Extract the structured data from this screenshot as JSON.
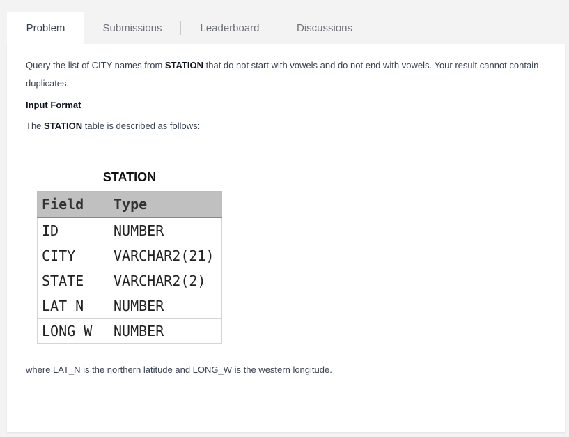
{
  "tabs": [
    {
      "label": "Problem",
      "active": true
    },
    {
      "label": "Submissions",
      "active": false
    },
    {
      "label": "Leaderboard",
      "active": false
    },
    {
      "label": "Discussions",
      "active": false
    }
  ],
  "problem": {
    "intro_prefix": "Query the list of CITY names from ",
    "intro_bold": "STATION",
    "intro_suffix": " that do not start with vowels and do not end with vowels. Your result cannot contain duplicates.",
    "input_format_heading": "Input Format",
    "table_desc_prefix": "The ",
    "table_desc_bold": "STATION",
    "table_desc_suffix": " table is described as follows:",
    "footer": "where LAT_N is the northern latitude and LONG_W is the western longitude."
  },
  "station_table": {
    "title": "STATION",
    "headers": [
      "Field",
      "Type"
    ],
    "rows": [
      [
        "ID",
        "NUMBER"
      ],
      [
        "CITY",
        "VARCHAR2(21)"
      ],
      [
        "STATE",
        "VARCHAR2(2)"
      ],
      [
        "LAT_N",
        "NUMBER"
      ],
      [
        "LONG_W",
        "NUMBER"
      ]
    ]
  },
  "colors": {
    "page_bg": "#f3f3f3",
    "panel_bg": "#ffffff",
    "text": "#39424e",
    "tab_inactive": "#6f7178",
    "table_header_bg": "#c0c0c0"
  }
}
